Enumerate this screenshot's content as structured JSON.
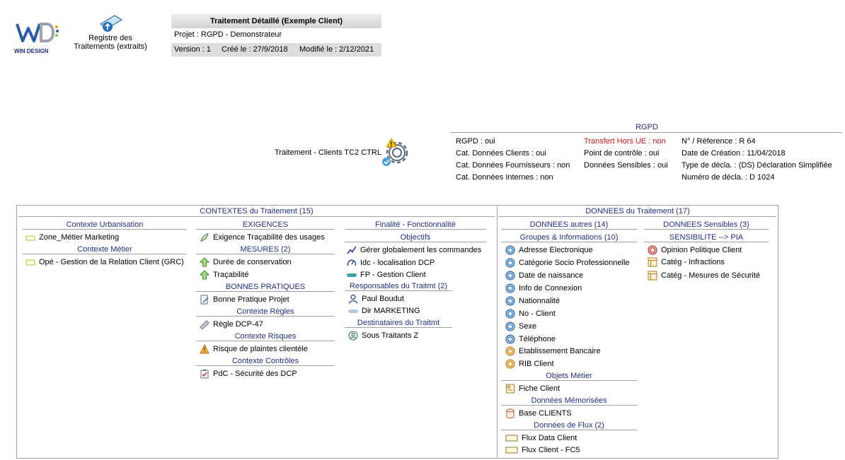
{
  "logo": {
    "letters": "WD",
    "brand": "WIN DESIGN"
  },
  "registre": {
    "line1": "Registre des",
    "line2": "Traitements (extraits)"
  },
  "header": {
    "title": "Traitement Détaillé (Exemple Client)",
    "projet": "Projet : RGPD - Demonstrateur",
    "version": "Version : 1",
    "cree": "Créé le : 27/9/2018",
    "modifie": "Modifié le : 2/12/2021"
  },
  "traitement": {
    "label": "Traitement - Clients TC2 CTRL"
  },
  "rgpd": {
    "title": "RGPD",
    "col1": [
      "RGPD : oui",
      "Cat. Données Clients : oui",
      "Cat. Données Fournisseurs : non",
      "Cat. Données Internes : non"
    ],
    "col2": [
      "Transfert Hors UE : non",
      "Point de contrôle : oui",
      "Données Sensibles : oui"
    ],
    "col3": [
      "N° / Réference : R 64",
      "Date de Création : 11/04/2018",
      "Type de décla. : (DS) Déclaration Simplifiée",
      "Numéro de décla. : D 1024"
    ]
  },
  "contextes": {
    "title": "CONTEXTES du Traitement (15)",
    "col1": {
      "h1": "Contexte Urbanisation",
      "i1": "Zone_Métier Marketing",
      "h2": "Contexte Métier",
      "i2": "Opé - Gestion de la Relation Client (GRC)"
    },
    "col2": {
      "h_exig": "EXIGENCES",
      "exig": "Exigence Traçabilité des usages",
      "h_mes": "MESURES (2)",
      "mes": [
        "Durée de conservation",
        "Traçabilité"
      ],
      "h_bp": "BONNES PRATIQUES",
      "bp": "Bonne Pratique Projet",
      "h_regles": "Contexte Règles",
      "regle": "Règle DCP-47",
      "h_risques": "Contexte Risques",
      "risque": "Risque de plaintes clientèle",
      "h_ctrl": "Contexte Contrôles",
      "ctrl": "PdC - Sécurité des DCP"
    },
    "col3": {
      "h_fin": "Finalité - Fonctionnalité",
      "h_obj": "Objectifs",
      "obj": [
        "Gérer globalement les commandes",
        "Idc - localisation DCP",
        "FP - Gestion Client"
      ],
      "h_resp": "Responsables du Traitmt (2)",
      "resp": [
        "Paul Boudut",
        "Dir MARKETING"
      ],
      "h_dest": "Destinataires du Traitmt",
      "dest": "Sous Traitants Z"
    }
  },
  "donnees": {
    "title": "DONNEES du Traitement (17)",
    "autres": {
      "h": "DONNEES autres (14)",
      "h_groupes": "Groupes & Informations (10)",
      "groupes": [
        "Adresse Electronique",
        "Catégorie Socio Professionnelle",
        "Date de naissance",
        "Info de Connexion",
        "Nationnalité",
        "No - Client",
        "Sexe",
        "Téléphone",
        "Etablissement Bancaire",
        "RIB Client"
      ],
      "h_obj": "Objets Métier",
      "obj": "Fiche Client",
      "h_mem": "Données Mémorisées",
      "mem": "Base CLIENTS",
      "h_flux": "Données de Flux (2)",
      "flux": [
        "Flux Data Client",
        "Flux Client - FC5"
      ]
    },
    "sensibles": {
      "h": "DONNEES Sensibles (3)",
      "h_sens": "SENSIBILITE --> PIA",
      "items": [
        "Opinion Politique Client",
        "Catég - Infractions",
        "Catég - Mesures de Sécurité"
      ]
    }
  },
  "colors": {
    "navy": "#1f2f7a",
    "red": "#d2141e",
    "headerGray": "#dcdcdc"
  }
}
